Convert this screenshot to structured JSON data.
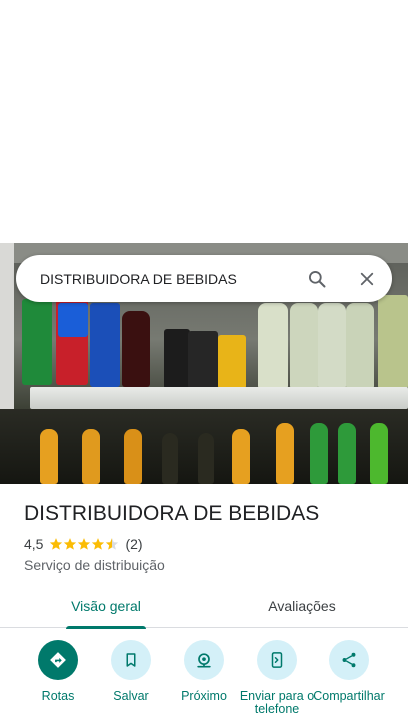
{
  "search": {
    "query": "DISTRIBUIDORA DE BEBIDAS"
  },
  "photo": {
    "description_icon": "storefront-photo"
  },
  "place": {
    "title": "DISTRIBUIDORA DE BEBIDAS",
    "rating": "4,5",
    "rating_value": 4.5,
    "review_count": "(2)",
    "category": "Serviço de distribuição"
  },
  "tabs": [
    {
      "label": "Visão geral",
      "selected": true
    },
    {
      "label": "Avaliações",
      "selected": false
    }
  ],
  "actions": [
    {
      "label": "Rotas",
      "icon": "directions-icon"
    },
    {
      "label": "Salvar",
      "icon": "bookmark-icon"
    },
    {
      "label": "Próximo",
      "icon": "nearby-icon"
    },
    {
      "label": "Enviar para o telefone",
      "icon": "send-to-phone-icon"
    },
    {
      "label": "Compartilhar",
      "icon": "share-icon"
    }
  ],
  "colors": {
    "accent": "#00796b",
    "action_bg": "#d4f0f8",
    "star": "#fbbc04"
  }
}
